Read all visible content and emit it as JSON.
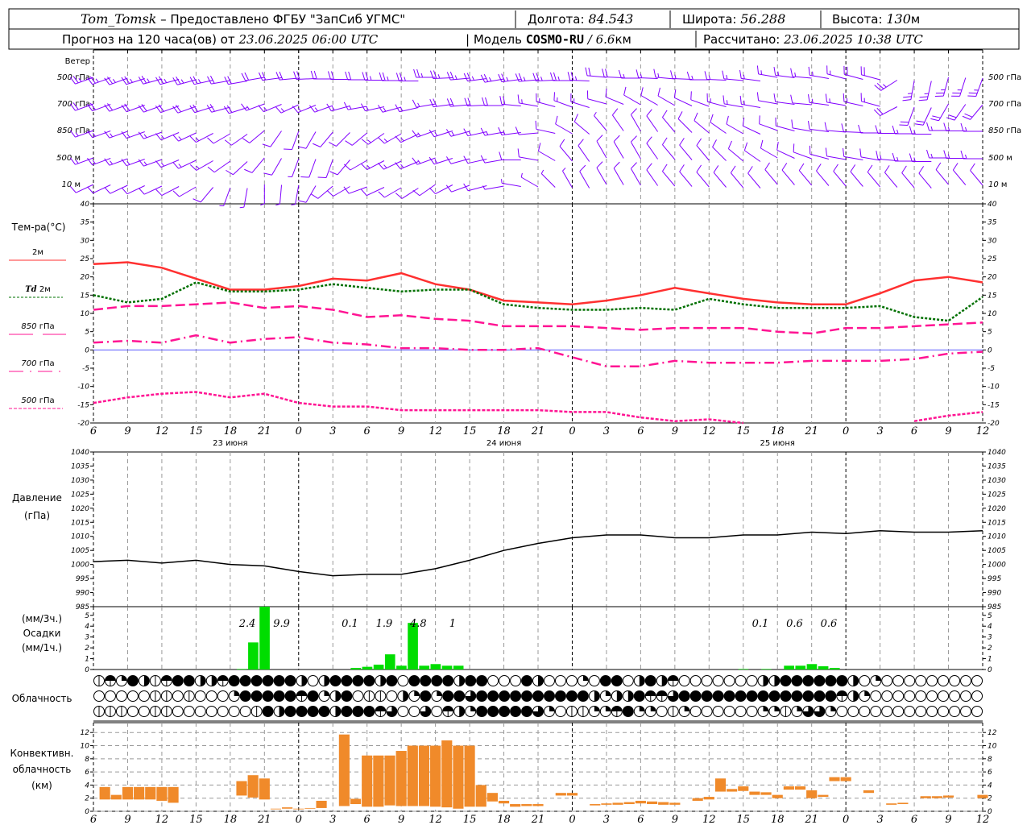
{
  "header": {
    "station": "Tom_Tomsk",
    "provider": " – Предоставлено ФГБУ \"ЗапСиб УГМС\"",
    "lon_label": "Долгота:",
    "lon": "84.543",
    "lat_label": "Широта:",
    "lat": "56.288",
    "alt_label": "Высота:",
    "alt": "130",
    "alt_unit": "м",
    "forecast_label": "Прогноз на 120 часа(ов) от",
    "forecast_time": "23.06.2025 06:00 UTC",
    "model_label": "| Модель",
    "model": "COSMO-RU",
    "model_res": "/ 6.6",
    "model_res_unit": "км",
    "calc_label": "Рассчитано:",
    "calc_time": "23.06.2025 10:38 UTC"
  },
  "time_axis": {
    "hour_labels": [
      "6",
      "9",
      "12",
      "15",
      "18",
      "21",
      "0",
      "3",
      "6",
      "9",
      "12",
      "15",
      "18",
      "21",
      "0",
      "3",
      "6",
      "9",
      "12",
      "15",
      "18",
      "21",
      "0",
      "3",
      "6",
      "9",
      "12"
    ],
    "day_labels": [
      "23 июня",
      "24 июня",
      "25 июня"
    ],
    "day_label_hours": [
      12,
      36,
      60
    ],
    "midnight_hours": [
      18,
      42,
      66
    ]
  },
  "wind": {
    "title": "Ветер",
    "levels": [
      {
        "label_num": "500",
        "label_unit": "гПа",
        "dir": [
          250,
          250,
          255,
          255,
          260,
          260,
          265,
          270,
          270,
          270,
          270,
          265,
          260,
          265,
          270,
          275,
          270,
          275,
          270,
          275,
          280,
          275,
          285,
          285,
          190,
          195,
          200
        ],
        "speed": [
          25,
          25,
          25,
          25,
          20,
          20,
          20,
          20,
          20,
          25,
          25,
          25,
          25,
          25,
          25,
          20,
          15,
          15,
          15,
          15,
          15,
          15,
          15,
          20,
          25,
          25,
          25
        ]
      },
      {
        "label_num": "700",
        "label_unit": "гПа",
        "dir": [
          250,
          250,
          250,
          250,
          255,
          250,
          245,
          250,
          260,
          255,
          260,
          265,
          270,
          280,
          290,
          285,
          300,
          300,
          290,
          280,
          280,
          275,
          280,
          285,
          200,
          210,
          220
        ],
        "speed": [
          20,
          20,
          20,
          20,
          20,
          15,
          15,
          15,
          15,
          15,
          15,
          20,
          20,
          15,
          15,
          10,
          10,
          10,
          10,
          15,
          10,
          10,
          15,
          15,
          20,
          20,
          20
        ]
      },
      {
        "label_num": "850",
        "label_unit": "гПа",
        "dir": [
          250,
          250,
          250,
          245,
          240,
          230,
          200,
          220,
          230,
          240,
          250,
          255,
          260,
          265,
          300,
          320,
          330,
          320,
          310,
          300,
          290,
          280,
          275,
          270,
          270,
          270,
          270
        ],
        "speed": [
          15,
          15,
          15,
          15,
          10,
          10,
          10,
          10,
          10,
          15,
          15,
          15,
          15,
          10,
          10,
          5,
          10,
          10,
          10,
          10,
          10,
          10,
          10,
          10,
          15,
          15,
          15
        ]
      },
      {
        "label_num": "500",
        "label_unit": "м",
        "dir": [
          250,
          250,
          250,
          245,
          235,
          220,
          200,
          200,
          240,
          245,
          250,
          255,
          260,
          280,
          320,
          330,
          330,
          320,
          320,
          310,
          300,
          290,
          280,
          280,
          270,
          270,
          270
        ],
        "speed": [
          15,
          15,
          15,
          15,
          10,
          10,
          5,
          10,
          10,
          15,
          15,
          10,
          10,
          10,
          10,
          10,
          10,
          10,
          10,
          10,
          10,
          10,
          10,
          10,
          15,
          15,
          15
        ]
      },
      {
        "label_num": "10",
        "label_unit": "м",
        "dir": [
          245,
          245,
          245,
          240,
          200,
          180,
          190,
          230,
          250,
          240,
          235,
          250,
          260,
          300,
          330,
          330,
          330,
          320,
          320,
          320,
          320,
          320,
          320,
          320,
          320,
          320,
          320
        ],
        "speed": [
          10,
          10,
          10,
          10,
          5,
          5,
          5,
          10,
          10,
          10,
          10,
          10,
          5,
          5,
          5,
          10,
          10,
          10,
          10,
          10,
          10,
          10,
          10,
          10,
          10,
          10,
          10
        ]
      }
    ],
    "color": "#8000ff"
  },
  "temperature": {
    "title": "Тем-ра(°С)",
    "ylim": [
      -20,
      40
    ],
    "yticks": [
      40,
      35,
      30,
      25,
      20,
      15,
      10,
      5,
      0,
      -5,
      -10,
      -15,
      -20
    ],
    "hours": [
      0,
      3,
      6,
      9,
      12,
      15,
      18,
      21,
      24,
      27,
      30,
      33,
      36,
      39,
      42,
      45,
      48,
      51,
      54,
      57,
      60,
      63,
      66,
      69,
      72,
      75,
      78
    ],
    "series": [
      {
        "name": "2м",
        "prefix": "",
        "color": "#ff3030",
        "dash": "",
        "values": [
          23.5,
          24,
          22.5,
          19.5,
          16.5,
          16.5,
          17.5,
          19.5,
          19,
          21,
          18,
          16.5,
          13.5,
          13,
          12.5,
          13.5,
          15,
          17,
          15.5,
          14,
          13,
          12.5,
          12.5,
          15.5,
          19,
          20,
          18.5
        ]
      },
      {
        "name": "2м",
        "prefix": "Td",
        "color": "#007000",
        "dash": "3,2",
        "values": [
          15,
          13,
          14,
          18.5,
          16,
          16,
          16.5,
          18,
          17,
          16,
          16.5,
          16.5,
          12.5,
          11.5,
          11,
          11,
          11.5,
          11,
          14,
          12.5,
          11.5,
          11.5,
          11.5,
          12,
          9,
          8,
          14.5
        ]
      },
      {
        "name": "гПа",
        "prefix": "850",
        "color": "#ff1493",
        "dash": "12,5",
        "values": [
          11,
          12,
          12,
          12.5,
          13,
          11.5,
          12,
          11,
          9,
          9.5,
          8.5,
          8,
          6.5,
          6.5,
          6.5,
          6,
          5.5,
          6,
          6,
          6,
          5,
          4.5,
          6,
          6,
          6.5,
          7,
          7.5
        ]
      },
      {
        "name": "гПа",
        "prefix": "700",
        "color": "#ff1493",
        "dash": "12,5,2,5",
        "values": [
          2,
          2.5,
          2,
          4,
          2,
          3,
          3.5,
          2,
          1.5,
          0.5,
          0.5,
          0,
          0,
          0.5,
          -2,
          -4.5,
          -4.5,
          -3,
          -3.5,
          -3.5,
          -3.5,
          -3,
          -3,
          -3,
          -2.5,
          -1,
          -0.5
        ]
      },
      {
        "name": "гПа",
        "prefix": "500",
        "color": "#ff1493",
        "dash": "4,2",
        "values": [
          -14.5,
          -13,
          -12,
          -11.5,
          -13,
          -12,
          -14.5,
          -15.5,
          -15.5,
          -16.5,
          -16.5,
          -16.5,
          -16.5,
          -16.5,
          -17,
          -17,
          -18.5,
          -19.5,
          -19,
          -20,
          null,
          null,
          null,
          null,
          -19.5,
          -18,
          -17
        ]
      }
    ],
    "zero_line_color": "#4040ff"
  },
  "pressure": {
    "title": "Давление",
    "unit": "(гПа)",
    "ylim": [
      985,
      1040
    ],
    "yticks": [
      1040,
      1035,
      1030,
      1025,
      1020,
      1015,
      1010,
      1005,
      1000,
      995,
      990,
      985
    ],
    "hours": [
      0,
      3,
      6,
      9,
      12,
      15,
      18,
      21,
      24,
      27,
      30,
      33,
      36,
      39,
      42,
      45,
      48,
      51,
      54,
      57,
      60,
      63,
      66,
      69,
      72,
      75,
      78
    ],
    "values": [
      1001,
      1001.5,
      1000.5,
      1001.5,
      1000,
      999.5,
      997.5,
      996,
      996.5,
      996.5,
      998.5,
      1001.5,
      1005,
      1007.5,
      1009.5,
      1010.5,
      1010.5,
      1009.5,
      1009.5,
      1010.5,
      1010.5,
      1011.5,
      1011,
      1012,
      1011.5,
      1011.5,
      1012
    ]
  },
  "precipitation": {
    "title": "Осадки",
    "unit_3h": "(мм/3ч.)",
    "unit_1h": "(мм/1ч.)",
    "ylim": [
      0,
      5.8
    ],
    "yticks": [
      0,
      1,
      2,
      3,
      4,
      5
    ],
    "color": "#00dd00",
    "hourly": [
      {
        "hour": 13,
        "mm": 0.05
      },
      {
        "hour": 14,
        "mm": 2.5
      },
      {
        "hour": 15,
        "mm": 6.0
      },
      {
        "hour": 23,
        "mm": 0.15
      },
      {
        "hour": 24,
        "mm": 0.25
      },
      {
        "hour": 25,
        "mm": 0.45
      },
      {
        "hour": 26,
        "mm": 1.4
      },
      {
        "hour": 27,
        "mm": 0.35
      },
      {
        "hour": 28,
        "mm": 4.3
      },
      {
        "hour": 29,
        "mm": 0.35
      },
      {
        "hour": 30,
        "mm": 0.5
      },
      {
        "hour": 31,
        "mm": 0.35
      },
      {
        "hour": 32,
        "mm": 0.35
      },
      {
        "hour": 57,
        "mm": 0.05
      },
      {
        "hour": 59,
        "mm": 0.05
      },
      {
        "hour": 61,
        "mm": 0.35
      },
      {
        "hour": 62,
        "mm": 0.35
      },
      {
        "hour": 63,
        "mm": 0.5
      },
      {
        "hour": 64,
        "mm": 0.3
      },
      {
        "hour": 65,
        "mm": 0.15
      }
    ],
    "totals_3h": [
      {
        "hour": 12,
        "value": "2.4"
      },
      {
        "hour": 15,
        "value": "9.9"
      },
      {
        "hour": 21,
        "value": "0.1"
      },
      {
        "hour": 24,
        "value": "1.9"
      },
      {
        "hour": 27,
        "value": "4.8"
      },
      {
        "hour": 30,
        "value": "1"
      },
      {
        "hour": 57,
        "value": "0.1"
      },
      {
        "hour": 60,
        "value": "0.6"
      },
      {
        "hour": 63,
        "value": "0.6"
      }
    ]
  },
  "cloudiness": {
    "title": "Облачность",
    "rows": [
      "vhqfbvhffbbhffffffbobffffbfoffffbffooofboooqoffobfbhooooooobbffffffboqoooooooooo",
      "ooooovvovoooqfffffhfqbfovvobqfqfftffffffffffbqbbfhhtffffffffffffffhbqoooooooooo",
      "vvvoovvooooooovfbffffbfffhtootohbqffffftqovvqqhfqqovqooooooqqvqttqooooooooooooo"
    ]
  },
  "convective": {
    "title_1": "Конвективн.",
    "title_2": "облачность",
    "unit": "(км)",
    "ylim": [
      0,
      13.5
    ],
    "yticks": [
      0,
      2,
      4,
      6,
      8,
      10,
      12
    ],
    "color": "#f08a2a",
    "bars": [
      {
        "hour": 0,
        "base": 1.8,
        "top": 3.7
      },
      {
        "hour": 1,
        "base": 1.8,
        "top": 2.5
      },
      {
        "hour": 2,
        "base": 1.8,
        "top": 3.7
      },
      {
        "hour": 3,
        "base": 1.8,
        "top": 3.7
      },
      {
        "hour": 4,
        "base": 1.8,
        "top": 3.7
      },
      {
        "hour": 5,
        "base": 1.6,
        "top": 3.7
      },
      {
        "hour": 6,
        "base": 1.3,
        "top": 3.7
      },
      {
        "hour": 12,
        "base": 2.4,
        "top": 4.6
      },
      {
        "hour": 13,
        "base": 2.1,
        "top": 5.5
      },
      {
        "hour": 14,
        "base": 1.8,
        "top": 5.0
      },
      {
        "hour": 15,
        "base": 0.3,
        "top": 0.4
      },
      {
        "hour": 16,
        "base": 0.4,
        "top": 0.6
      },
      {
        "hour": 17,
        "base": 0.3,
        "top": 0.4
      },
      {
        "hour": 18,
        "base": 0.4,
        "top": 0.5
      },
      {
        "hour": 19,
        "base": 0.5,
        "top": 1.6
      },
      {
        "hour": 21,
        "base": 0.8,
        "top": 11.7
      },
      {
        "hour": 22,
        "base": 1.1,
        "top": 1.9
      },
      {
        "hour": 23,
        "base": 0.7,
        "top": 8.5
      },
      {
        "hour": 24,
        "base": 0.7,
        "top": 8.5
      },
      {
        "hour": 25,
        "base": 0.9,
        "top": 8.5
      },
      {
        "hour": 26,
        "base": 0.8,
        "top": 9.2
      },
      {
        "hour": 27,
        "base": 0.8,
        "top": 10
      },
      {
        "hour": 28,
        "base": 0.8,
        "top": 10
      },
      {
        "hour": 29,
        "base": 0.7,
        "top": 10
      },
      {
        "hour": 30,
        "base": 0.6,
        "top": 10.8
      },
      {
        "hour": 31,
        "base": 0.4,
        "top": 10
      },
      {
        "hour": 32,
        "base": 0.7,
        "top": 10
      },
      {
        "hour": 33,
        "base": 0.7,
        "top": 4.0
      },
      {
        "hour": 34,
        "base": 1.5,
        "top": 2.8
      },
      {
        "hour": 35,
        "base": 1.2,
        "top": 1.6
      },
      {
        "hour": 36,
        "base": 0.7,
        "top": 1.1
      },
      {
        "hour": 37,
        "base": 0.8,
        "top": 1.1
      },
      {
        "hour": 38,
        "base": 0.8,
        "top": 1.1
      },
      {
        "hour": 40,
        "base": 2.4,
        "top": 2.8
      },
      {
        "hour": 41,
        "base": 2.4,
        "top": 2.8
      },
      {
        "hour": 43,
        "base": 0.9,
        "top": 1.1
      },
      {
        "hour": 44,
        "base": 1.0,
        "top": 1.2
      },
      {
        "hour": 45,
        "base": 1.0,
        "top": 1.3
      },
      {
        "hour": 46,
        "base": 1.1,
        "top": 1.4
      },
      {
        "hour": 47,
        "base": 1.2,
        "top": 1.6
      },
      {
        "hour": 48,
        "base": 1.1,
        "top": 1.5
      },
      {
        "hour": 49,
        "base": 1.0,
        "top": 1.4
      },
      {
        "hour": 50,
        "base": 1.0,
        "top": 1.3
      },
      {
        "hour": 52,
        "base": 1.6,
        "top": 2.0
      },
      {
        "hour": 53,
        "base": 1.8,
        "top": 2.2
      },
      {
        "hour": 54,
        "base": 3.0,
        "top": 5.0
      },
      {
        "hour": 55,
        "base": 3.0,
        "top": 3.4
      },
      {
        "hour": 56,
        "base": 3.1,
        "top": 3.8
      },
      {
        "hour": 57,
        "base": 2.5,
        "top": 3.0
      },
      {
        "hour": 58,
        "base": 2.5,
        "top": 2.9
      },
      {
        "hour": 59,
        "base": 2.0,
        "top": 2.5
      },
      {
        "hour": 60,
        "base": 3.3,
        "top": 3.8
      },
      {
        "hour": 61,
        "base": 3.3,
        "top": 3.8
      },
      {
        "hour": 62,
        "base": 2.0,
        "top": 3.2
      },
      {
        "hour": 63,
        "base": 2.2,
        "top": 2.5
      },
      {
        "hour": 64,
        "base": 4.6,
        "top": 5.2
      },
      {
        "hour": 65,
        "base": 4.6,
        "top": 5.2
      },
      {
        "hour": 67,
        "base": 2.8,
        "top": 3.2
      },
      {
        "hour": 69,
        "base": 1.0,
        "top": 1.2
      },
      {
        "hour": 70,
        "base": 1.1,
        "top": 1.3
      },
      {
        "hour": 72,
        "base": 2.0,
        "top": 2.3
      },
      {
        "hour": 73,
        "base": 2.0,
        "top": 2.3
      },
      {
        "hour": 74,
        "base": 2.1,
        "top": 2.4
      },
      {
        "hour": 77,
        "base": 2.0,
        "top": 2.5
      }
    ]
  }
}
